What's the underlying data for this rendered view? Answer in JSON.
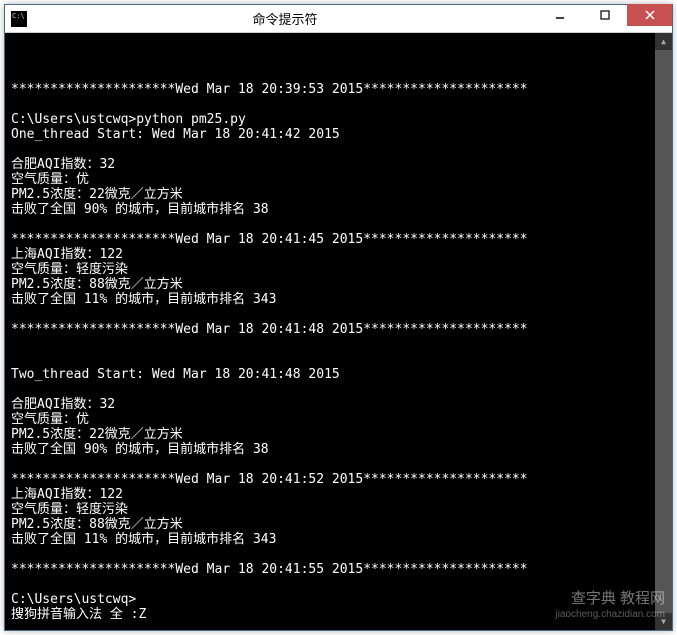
{
  "window": {
    "title": "命令提示符"
  },
  "terminal": {
    "lines": [
      "",
      "*********************Wed Mar 18 20:39:53 2015*********************",
      "",
      "C:\\Users\\ustcwq>python pm25.py",
      "One_thread Start: Wed Mar 18 20:41:42 2015",
      "",
      "合肥AQI指数：32",
      "空气质量：优",
      "PM2.5浓度：22微克／立方米",
      "击败了全国 90% 的城市，目前城市排名 38",
      "",
      "*********************Wed Mar 18 20:41:45 2015*********************",
      "上海AQI指数：122",
      "空气质量：轻度污染",
      "PM2.5浓度：88微克／立方米",
      "击败了全国 11% 的城市，目前城市排名 343",
      "",
      "*********************Wed Mar 18 20:41:48 2015*********************",
      "",
      "",
      "Two_thread Start: Wed Mar 18 20:41:48 2015",
      "",
      "合肥AQI指数：32",
      "空气质量：优",
      "PM2.5浓度：22微克／立方米",
      "击败了全国 90% 的城市，目前城市排名 38",
      "",
      "*********************Wed Mar 18 20:41:52 2015*********************",
      "上海AQI指数：122",
      "空气质量：轻度污染",
      "PM2.5浓度：88微克／立方米",
      "击败了全国 11% 的城市，目前城市排名 343",
      "",
      "*********************Wed Mar 18 20:41:55 2015*********************",
      "",
      "C:\\Users\\ustcwq>",
      "搜狗拼音输入法 全 :Z"
    ]
  },
  "watermark": {
    "main": "查字典 教程网",
    "sub": "jiaocheng.chazidian.com"
  }
}
